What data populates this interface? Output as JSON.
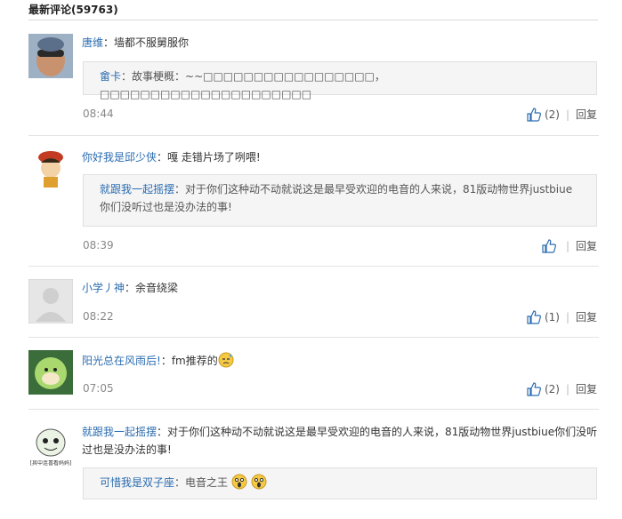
{
  "header": {
    "title": "最新评论(59763)"
  },
  "comments": [
    {
      "author": "唐维",
      "text": "：墙都不服舅服你",
      "quote": {
        "author": "畲卡",
        "text": "：故事梗概：~~□□□□□□□□□□□□□□□□□，□□□□□□□□□□□□□□□□□□□□□"
      },
      "time": "08:44",
      "likes": "(2)",
      "reply": "回复"
    },
    {
      "author": "你好我是邱少侠",
      "text": "：嘎 走错片场了咧喂!",
      "quote": {
        "author": "就跟我一起摇摆",
        "text": "：对于你们这种动不动就说这是最早受欢迎的电音的人来说，81版动物世界justbiue你们没听过也是没办法的事!"
      },
      "time": "08:39",
      "likes": "",
      "reply": "回复"
    },
    {
      "author": "小学丿神",
      "text": "：余音绕梁",
      "time": "08:22",
      "likes": "(1)",
      "reply": "回复"
    },
    {
      "author": "阳光总在风雨后!",
      "text": "：fm推荐的",
      "time": "07:05",
      "likes": "(2)",
      "reply": "回复"
    },
    {
      "author": "就跟我一起摇摆",
      "text": "：对于你们这种动不动就说这是最早受欢迎的电音的人来说，81版动物世界justbiue你们没听过也是没办法的事!",
      "avatar_caption": "[其中连喜看妈妈]",
      "quote": {
        "author": "可惜我是双子座",
        "text": "：电音之王"
      }
    }
  ]
}
